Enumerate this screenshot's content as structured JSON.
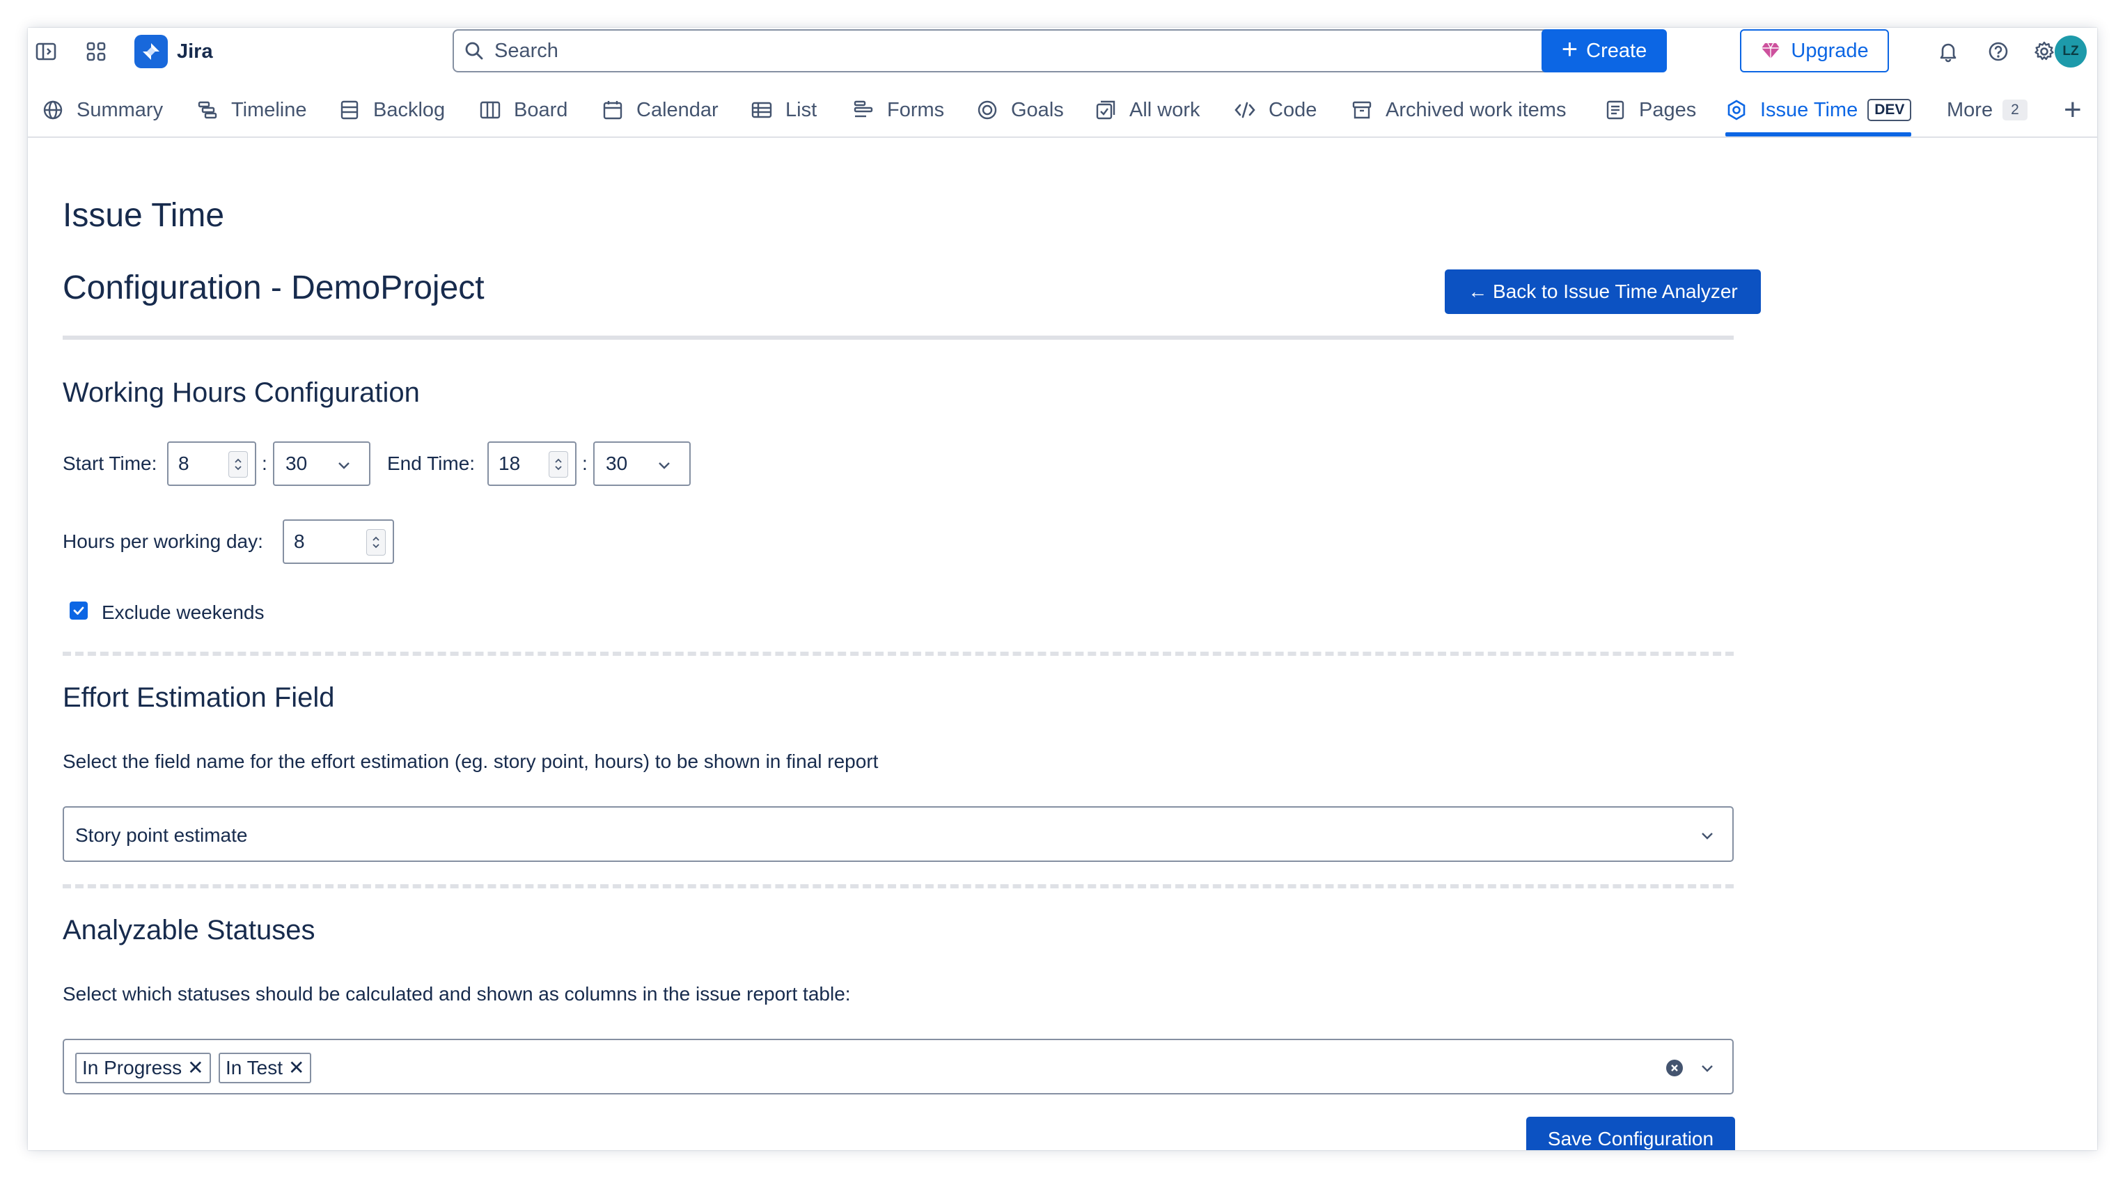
{
  "topbar": {
    "app_name": "Jira",
    "search_placeholder": "Search",
    "create_label": "Create",
    "upgrade_label": "Upgrade",
    "avatar_initials": "LZ",
    "icons": [
      "sidebar-toggle-icon",
      "app-switcher-icon",
      "jira-logo",
      "search-icon",
      "bell-icon",
      "help-icon",
      "gear-icon"
    ]
  },
  "tabs": {
    "items": [
      {
        "label": "Summary",
        "icon": "globe-icon"
      },
      {
        "label": "Timeline",
        "icon": "timeline-icon"
      },
      {
        "label": "Backlog",
        "icon": "backlog-icon"
      },
      {
        "label": "Board",
        "icon": "board-icon"
      },
      {
        "label": "Calendar",
        "icon": "calendar-icon"
      },
      {
        "label": "List",
        "icon": "list-icon"
      },
      {
        "label": "Forms",
        "icon": "forms-icon"
      },
      {
        "label": "Goals",
        "icon": "goal-icon"
      },
      {
        "label": "All work",
        "icon": "all-work-icon"
      },
      {
        "label": "Code",
        "icon": "code-icon"
      },
      {
        "label": "Archived work items",
        "icon": "archive-icon"
      },
      {
        "label": "Pages",
        "icon": "page-icon"
      },
      {
        "label": "Issue Time",
        "icon": "issue-time-icon",
        "active": true,
        "badge": "DEV"
      }
    ],
    "more_label": "More",
    "more_count": "2",
    "add_icon": "plus-icon"
  },
  "page": {
    "app_title": "Issue Time",
    "config_title": "Configuration - DemoProject",
    "back_button": "← Back to Issue Time Analyzer"
  },
  "working_hours": {
    "title": "Working Hours Configuration",
    "start_label": "Start Time:",
    "start_hour": "8",
    "start_minute": "30",
    "end_label": "End Time:",
    "end_hour": "18",
    "end_minute": "30",
    "colon": ":",
    "hours_label": "Hours per working day:",
    "hours_value": "8",
    "exclude_weekends_label": "Exclude weekends",
    "exclude_weekends_checked": true
  },
  "effort": {
    "title": "Effort Estimation Field",
    "description": "Select the field name for the effort estimation (eg. story point, hours) to be shown in final report",
    "selected": "Story point estimate"
  },
  "statuses": {
    "title": "Analyzable Statuses",
    "description": "Select which statuses should be calculated and shown as columns in the issue report table:",
    "chips": [
      "In Progress",
      "In Test"
    ]
  },
  "save_button": "Save Configuration",
  "colors": {
    "accent": "#0c66e4",
    "button_dark": "#0c52c2",
    "text": "#172b4d",
    "subtle_text": "#44546f",
    "border": "#8590a2",
    "divider": "#dfe1e6",
    "avatar_bg": "#1d9aaa"
  }
}
